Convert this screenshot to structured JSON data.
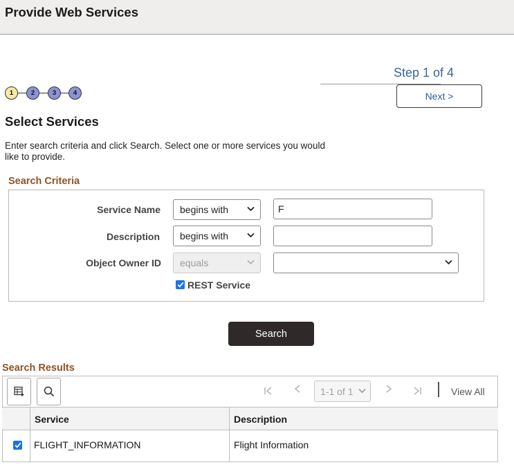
{
  "page": {
    "title": "Provide Web Services"
  },
  "wizard": {
    "step_label": "Step 1 of 4",
    "next_label": "Next >",
    "steps": [
      "1",
      "2",
      "3",
      "4"
    ],
    "current_step": 1
  },
  "section": {
    "title": "Select Services",
    "instructions": "Enter search criteria and click Search. Select one or more services you would like to provide."
  },
  "criteria": {
    "title": "Search Criteria",
    "service_name": {
      "label": "Service Name",
      "operator": "begins with",
      "value": "F"
    },
    "description": {
      "label": "Description",
      "operator": "begins with",
      "value": ""
    },
    "object_owner": {
      "label": "Object Owner ID",
      "operator": "equals",
      "value": ""
    },
    "rest_service": {
      "label": "REST Service",
      "checked": true
    },
    "search_label": "Search"
  },
  "results": {
    "title": "Search Results",
    "pagination": {
      "range": "1-1 of 1",
      "view_all": "View All"
    },
    "columns": [
      "Service",
      "Description"
    ],
    "rows": [
      {
        "checked": true,
        "service": "FLIGHT_INFORMATION",
        "description": "Flight Information"
      }
    ]
  },
  "icons": {
    "personalize": "grid-settings-icon",
    "find": "search-icon",
    "first": "first-page-icon",
    "prev": "previous-page-icon",
    "next": "next-page-icon",
    "last": "last-page-icon"
  },
  "colors": {
    "group_title": "#8f5325",
    "step_link": "#35679b",
    "step_dot": "#8c92d6",
    "current_step_dot": "#f5e9a6",
    "primary_button": "#2f2a29",
    "checkbox": "#1a73e8"
  }
}
